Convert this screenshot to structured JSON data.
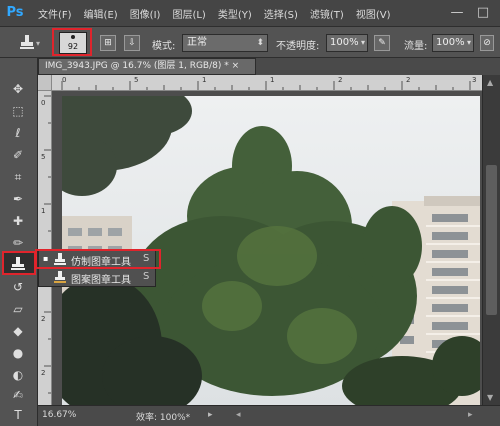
{
  "app": {
    "logo": "Ps"
  },
  "menu": [
    "文件(F)",
    "编辑(E)",
    "图像(I)",
    "图层(L)",
    "类型(Y)",
    "选择(S)",
    "滤镜(T)",
    "视图(V)"
  ],
  "window_buttons": {
    "minimize": "—",
    "maximize": "□"
  },
  "options": {
    "brush_size": "92",
    "mode_label": "模式:",
    "mode_value": "正常",
    "opacity_label": "不透明度:",
    "opacity_value": "100%",
    "flow_label": "流量:",
    "flow_value": "100%"
  },
  "document_tab": "IMG_3943.JPG @ 16.7% (图层 1, RGB/8) * ×",
  "ruler_h_labels": [
    "0",
    "5",
    "1",
    "1",
    "2",
    "2",
    "3"
  ],
  "ruler_v_labels": [
    "0",
    "5",
    "1",
    "1",
    "2",
    "2"
  ],
  "tools": [
    "move-icon",
    "marquee-icon",
    "lasso-icon",
    "quick-selection-icon",
    "crop-icon",
    "eyedropper-icon",
    "healing-brush-icon",
    "brush-icon",
    "clone-stamp-icon",
    "history-brush-icon",
    "eraser-icon",
    "paint-bucket-icon",
    "blur-icon",
    "dodge-icon",
    "pen-icon",
    "type-icon"
  ],
  "flyout": [
    {
      "label": "仿制图章工具",
      "key": "S",
      "active": true
    },
    {
      "label": "图案图章工具",
      "key": "S",
      "active": false
    }
  ],
  "status": {
    "zoom": "16.67%",
    "efficiency": "效率: 100%*"
  },
  "colors": {
    "highlight": "#e0242c",
    "ps_blue": "#31a8ff"
  }
}
